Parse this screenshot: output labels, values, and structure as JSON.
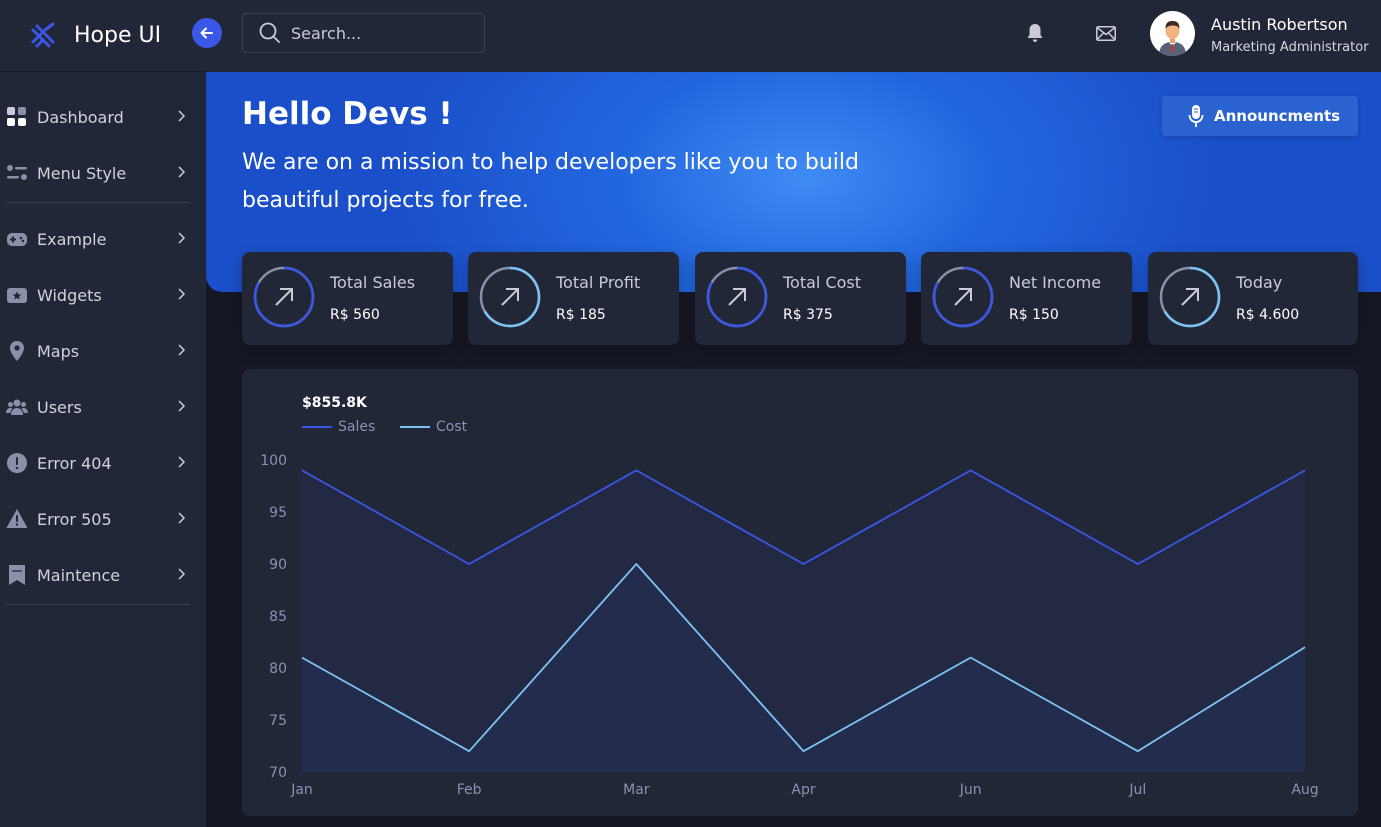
{
  "brand": {
    "name": "Hope UI"
  },
  "sidebar": {
    "items": [
      {
        "label": "Dashboard",
        "icon": "dashboard-icon"
      },
      {
        "label": "Menu Style",
        "icon": "menu-style-icon"
      },
      {
        "label": "Example",
        "icon": "gamepad-icon"
      },
      {
        "label": "Widgets",
        "icon": "widgets-icon"
      },
      {
        "label": "Maps",
        "icon": "map-pin-icon"
      },
      {
        "label": "Users",
        "icon": "users-icon"
      },
      {
        "label": "Error 404",
        "icon": "error-circle-icon"
      },
      {
        "label": "Error 505",
        "icon": "warning-triangle-icon"
      },
      {
        "label": "Maintence",
        "icon": "maintenance-icon"
      }
    ]
  },
  "header": {
    "search_placeholder": "Search...",
    "user": {
      "name": "Austin Robertson",
      "role": "Marketing Administrator"
    }
  },
  "hero": {
    "title": "Hello Devs !",
    "subtitle": "We are on a mission to help developers like you to build beautiful projects for free.",
    "announce_label": "Announcments"
  },
  "stats": [
    {
      "label": "Total Sales",
      "value": "R$ 560"
    },
    {
      "label": "Total Profit",
      "value": "R$ 185"
    },
    {
      "label": "Total Cost",
      "value": "R$ 375"
    },
    {
      "label": "Net Income",
      "value": "R$ 150"
    },
    {
      "label": "Today",
      "value": "R$ 4.600"
    }
  ],
  "colors": {
    "accent": "#3a57e8",
    "sales": "#3a57e8",
    "cost": "#7bc3f5",
    "panel": "#222738",
    "axis_text": "#8a92b2"
  },
  "chart_data": {
    "type": "area",
    "title": "$855.8K",
    "categories": [
      "Jan",
      "Feb",
      "Mar",
      "Apr",
      "Jun",
      "Jul",
      "Aug"
    ],
    "series": [
      {
        "name": "Sales",
        "values": [
          99,
          90,
          99,
          90,
          99,
          90,
          99
        ]
      },
      {
        "name": "Cost",
        "values": [
          81,
          72,
          90,
          72,
          81,
          72,
          82
        ]
      }
    ],
    "ylim": [
      70,
      100
    ],
    "yticks": [
      100,
      95,
      90,
      85,
      80,
      75,
      70
    ],
    "legend": "top-left",
    "grid": false
  }
}
